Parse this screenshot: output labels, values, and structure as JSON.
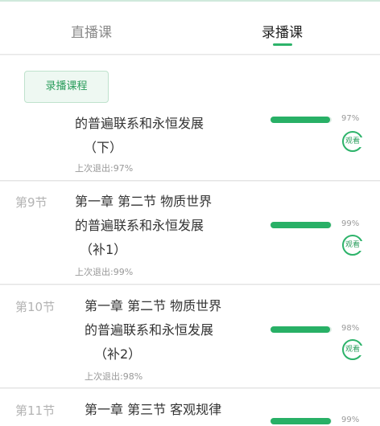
{
  "tabs": {
    "live": "直播课",
    "recorded": "录播课"
  },
  "course_button": "录播课程",
  "lessons": [
    {
      "number": "",
      "title_lines": [
        "的普遍联系和永恒发展",
        "（下）"
      ],
      "last_exit": "上次退出:97%",
      "progress_label": "97%",
      "progress": 0.97,
      "watch_label": "观看"
    },
    {
      "number": "第9节",
      "title_lines": [
        "第一章 第二节 物质世界",
        "的普遍联系和永恒发展",
        "（补1）"
      ],
      "last_exit": "上次退出:99%",
      "progress_label": "99%",
      "progress": 0.99,
      "watch_label": "观看"
    },
    {
      "number": "第10节",
      "title_lines": [
        "第一章 第二节 物质世界",
        "的普遍联系和永恒发展",
        "（补2）"
      ],
      "last_exit": "上次退出:98%",
      "progress_label": "98%",
      "progress": 0.98,
      "watch_label": "观看"
    },
    {
      "number": "第11节",
      "title_lines": [
        "第一章 第三节 客观规律"
      ],
      "last_exit": "",
      "progress_label": "99%",
      "progress": 0.99,
      "watch_label": ""
    }
  ],
  "colors": {
    "accent": "#2db36a",
    "bar_fill": "#28b066",
    "bar_track": "#dfeee6"
  }
}
